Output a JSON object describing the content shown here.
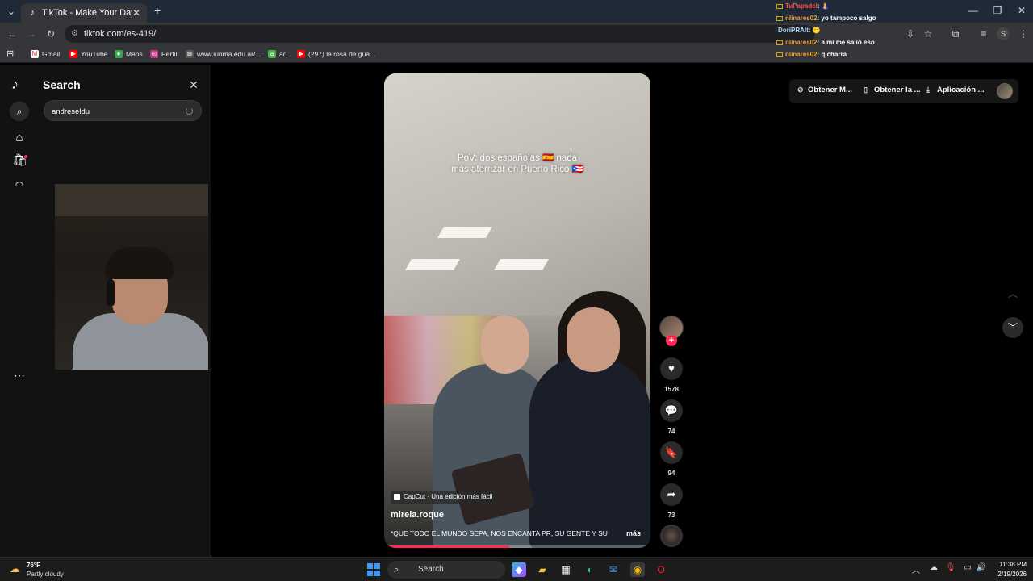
{
  "browser": {
    "tab_title": "TikTok - Make Your Day",
    "url": "tiktok.com/es-419/",
    "bookmarks": [
      {
        "label": "Gmail"
      },
      {
        "label": "YouTube"
      },
      {
        "label": "Maps"
      },
      {
        "label": "Perfil"
      },
      {
        "label": "www.iunma.edu.ar/..."
      },
      {
        "label": "ad"
      },
      {
        "label": "(297) la rosa de gua..."
      }
    ]
  },
  "chat": [
    {
      "user": "TuPapadel",
      "msg": ": 🤱",
      "color": "#ff4d4d"
    },
    {
      "user": "nlinares02",
      "msg": ": yo tampoco salgo",
      "color": "#f0a030"
    },
    {
      "user": "DoriPRAIt",
      "msg": ": 😑",
      "color": "#a8d8ff"
    },
    {
      "user": "nlinares02",
      "msg": ": a mi me salió eso",
      "color": "#f0a030"
    },
    {
      "user": "nlinares02",
      "msg": ": q charra",
      "color": "#f0a030"
    }
  ],
  "sidebar": {
    "search_title": "Search",
    "search_value": "andreseldu"
  },
  "video": {
    "overlay_text": "PoV: dos españolas 🇪🇸 nada más aterrizar en Puerto Rico 🇵🇷",
    "capcut_label": "CapCut · Una edición más fácil",
    "author": "mireia.roque",
    "description": "*QUE TODO EL MUNDO SEPA, NOS ENCANTA PR, SU GENTE Y SU",
    "more_label": "más",
    "progress_fraction": 0.47
  },
  "actions": {
    "likes": "1578",
    "comments": "74",
    "saves": "94",
    "shares": "73"
  },
  "topright": {
    "coins": "Obtener M...",
    "app": "Obtener la ...",
    "download": "Aplicación ..."
  },
  "taskbar": {
    "temp": "76°F",
    "condition": "Partly cloudy",
    "search_label": "Search",
    "time": "11:38 PM",
    "date": "2/19/2026"
  },
  "colors": {
    "accent": "#fe2c55",
    "windows_blue": "#3b9af5"
  }
}
